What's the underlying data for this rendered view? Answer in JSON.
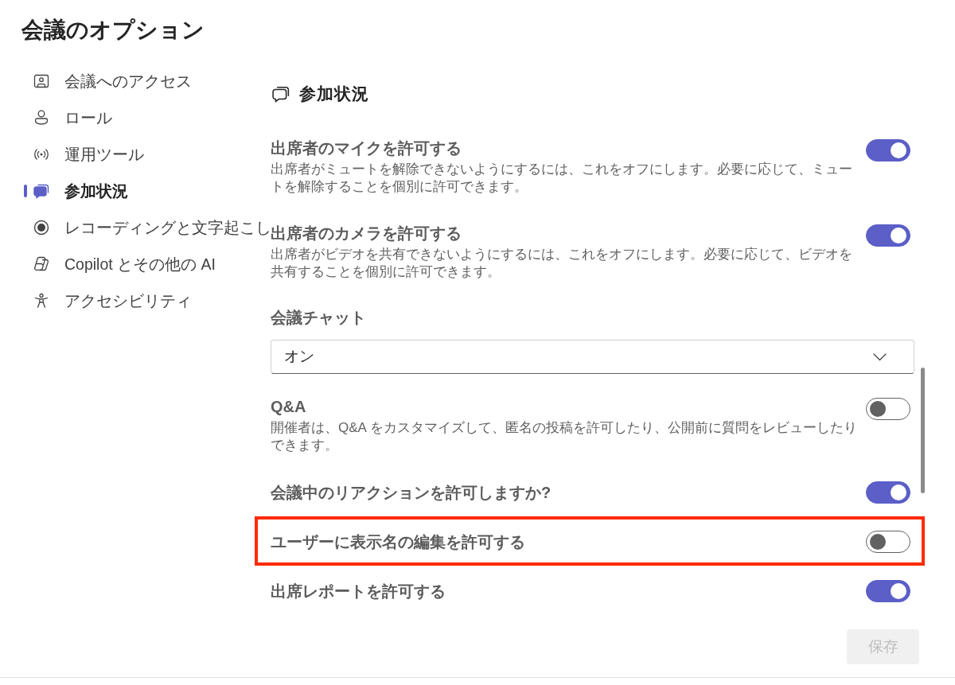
{
  "title": "会議のオプション",
  "sidebar": {
    "items": [
      {
        "label": "会議へのアクセス",
        "selected": false
      },
      {
        "label": "ロール",
        "selected": false
      },
      {
        "label": "運用ツール",
        "selected": false
      },
      {
        "label": "参加状況",
        "selected": true
      },
      {
        "label": "レコーディングと文字起こし",
        "selected": false
      },
      {
        "label": "Copilot とその他の AI",
        "selected": false
      },
      {
        "label": "アクセシビリティ",
        "selected": false
      }
    ]
  },
  "section": {
    "title": "参加状況"
  },
  "settings": [
    {
      "kind": "toggle",
      "title": "出席者のマイクを許可する",
      "description": "出席者がミュートを解除できないようにするには、これをオフにします。必要に応じて、ミュートを解除することを個別に許可できます。",
      "on": true,
      "highlighted": false
    },
    {
      "kind": "toggle",
      "title": "出席者のカメラを許可する",
      "description": "出席者がビデオを共有できないようにするには、これをオフにします。必要に応じて、ビデオを共有することを個別に許可できます。",
      "on": true,
      "highlighted": false
    },
    {
      "kind": "dropdown",
      "label": "会議チャット",
      "value": "オン",
      "highlighted": false
    },
    {
      "kind": "toggle",
      "title": "Q&A",
      "description": "開催者は、Q&A をカスタマイズして、匿名の投稿を許可したり、公開前に質問をレビューしたりできます。",
      "on": false,
      "highlighted": false
    },
    {
      "kind": "toggle",
      "title": "会議中のリアクションを許可しますか?",
      "on": true,
      "highlighted": false
    },
    {
      "kind": "toggle",
      "title": "ユーザーに表示名の編集を許可する",
      "on": false,
      "highlighted": true
    },
    {
      "kind": "toggle",
      "title": "出席レポートを許可する",
      "on": true,
      "highlighted": false
    }
  ],
  "save_button": {
    "label": "保存",
    "disabled": true
  }
}
